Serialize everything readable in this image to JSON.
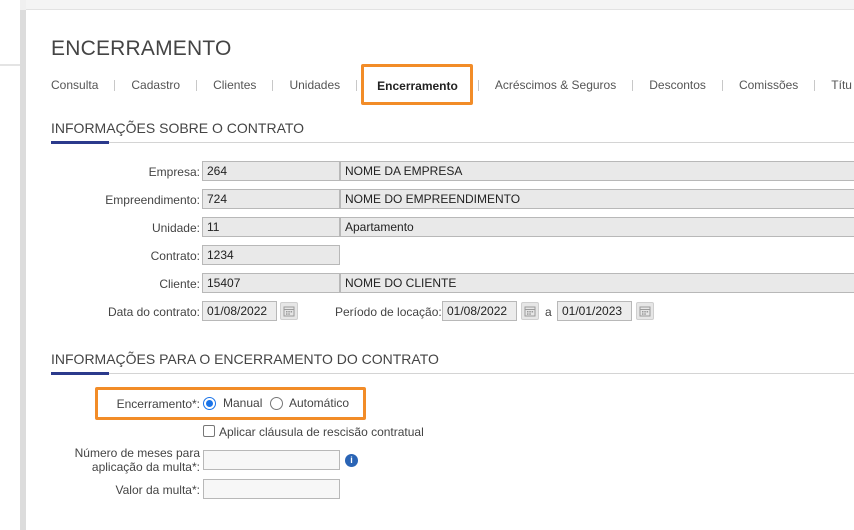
{
  "page": {
    "title": "ENCERRAMENTO"
  },
  "tabs": [
    {
      "label": "Consulta"
    },
    {
      "label": "Cadastro"
    },
    {
      "label": "Clientes"
    },
    {
      "label": "Unidades"
    },
    {
      "label": "Encerramento",
      "active": true
    },
    {
      "label": "Acréscimos & Seguros"
    },
    {
      "label": "Descontos"
    },
    {
      "label": "Comissões"
    },
    {
      "label": "Títu"
    }
  ],
  "contract_info": {
    "title": "INFORMAÇÕES SOBRE O CONTRATO",
    "empresa": {
      "label": "Empresa:",
      "code": "264",
      "name": "NOME DA EMPRESA"
    },
    "empreendimento": {
      "label": "Empreendimento:",
      "code": "724",
      "name": "NOME DO EMPREENDIMENTO"
    },
    "unidade": {
      "label": "Unidade:",
      "code": "11",
      "name": "Apartamento"
    },
    "contrato": {
      "label": "Contrato:",
      "code": "1234"
    },
    "cliente": {
      "label": "Cliente:",
      "code": "15407",
      "name": "NOME DO CLIENTE"
    },
    "data_contrato": {
      "label": "Data do contrato:",
      "value": "01/08/2022"
    },
    "periodo_locacao": {
      "label": "Período de locação:",
      "start": "01/08/2022",
      "separator": "a",
      "end": "01/01/2023"
    }
  },
  "closing_info": {
    "title": "INFORMAÇÕES PARA O ENCERRAMENTO DO CONTRATO",
    "encerramento": {
      "label": "Encerramento*:",
      "options": [
        {
          "label": "Manual",
          "checked": true
        },
        {
          "label": "Automático",
          "checked": false
        }
      ]
    },
    "clausula": {
      "label": "Aplicar cláusula de rescisão contratual",
      "checked": false
    },
    "meses_multa": {
      "label_line1": "Número de meses para",
      "label_line2": "aplicação da multa*:",
      "value": ""
    },
    "valor_multa": {
      "label": "Valor da multa*:",
      "value": ""
    }
  },
  "colors": {
    "accent_orange": "#f28c28",
    "accent_blue": "#2b3a8c",
    "radio_blue": "#1a73e8"
  },
  "icons": {
    "calendar": "calendar-icon",
    "info": "info-icon"
  }
}
